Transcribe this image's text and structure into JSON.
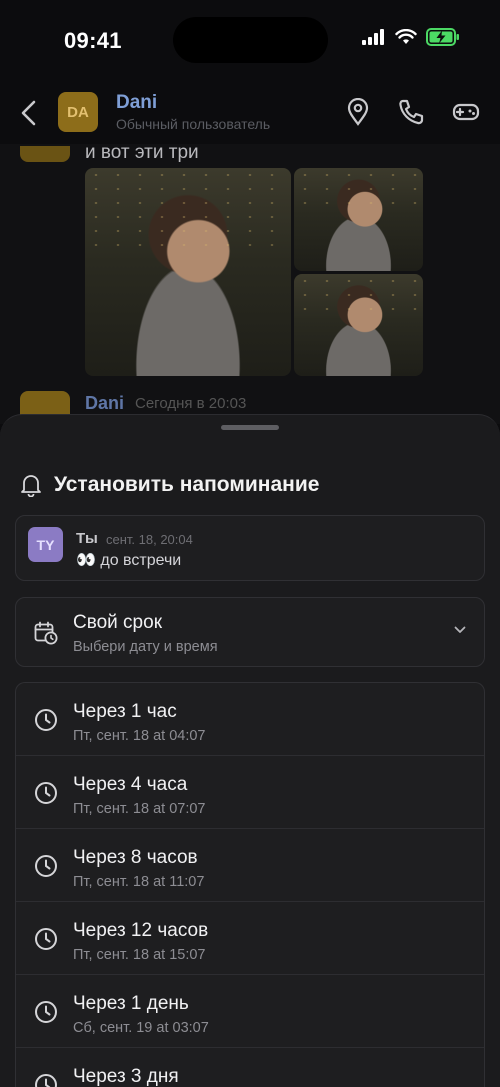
{
  "status_bar": {
    "time": "09:41"
  },
  "header": {
    "avatar_initials": "DA",
    "name": "Dani",
    "subtitle": "Обычный пользователь"
  },
  "chat": {
    "message_text": "и вот эти три",
    "next_message": {
      "name": "Dani",
      "time": "Сегодня в 20:03"
    }
  },
  "sheet": {
    "title": "Установить напоминание",
    "quoted": {
      "avatar_initials": "TY",
      "name": "Ты",
      "time": "сент. 18, 20:04",
      "text": "👀 до встречи"
    },
    "custom": {
      "title": "Свой срок",
      "subtitle": "Выбери дату и время"
    },
    "options": [
      {
        "title": "Через 1 час",
        "subtitle": "Пт, сент. 18 at 04:07"
      },
      {
        "title": "Через 4 часа",
        "subtitle": "Пт, сент. 18 at 07:07"
      },
      {
        "title": "Через 8 часов",
        "subtitle": "Пт, сент. 18 at 11:07"
      },
      {
        "title": "Через 12 часов",
        "subtitle": "Пт, сент. 18 at 15:07"
      },
      {
        "title": "Через 1 день",
        "subtitle": "Сб, сент. 19 at 03:07"
      },
      {
        "title": "Через 3 дня",
        "subtitle": ""
      }
    ]
  },
  "colors": {
    "accent_name": "#7f9fd6",
    "battery_green": "#4cd964",
    "avatar_gold": "#8d6d1a",
    "avatar_purple": "#8b7bc4"
  }
}
